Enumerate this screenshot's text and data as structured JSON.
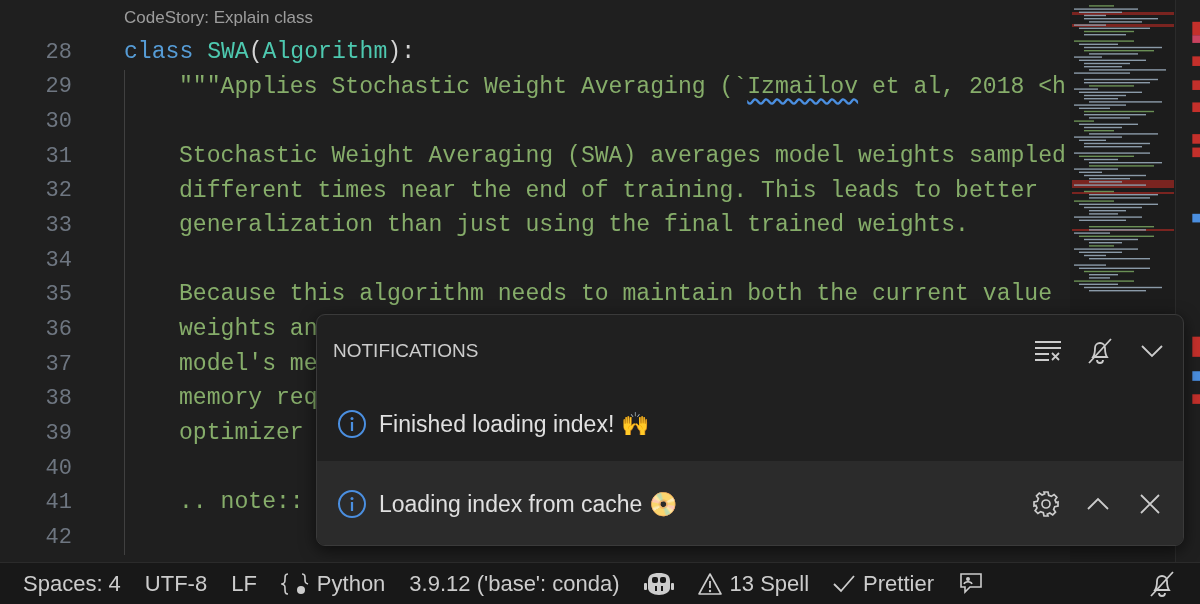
{
  "codelens": "CodeStory: Explain class",
  "lines": [
    {
      "number": "28",
      "indented": false,
      "tokens": [
        {
          "kind": "keyword",
          "text": "class"
        },
        {
          "kind": "class",
          "text": "SWA"
        },
        {
          "kind": "punct",
          "text": "("
        },
        {
          "kind": "class",
          "text": "Algorithm"
        },
        {
          "kind": "punct",
          "text": "):"
        }
      ]
    },
    {
      "number": "29",
      "indented": true,
      "tokens": [
        {
          "kind": "string",
          "text": "\"\"\"Applies Stochastic Weight Averaging (`"
        },
        {
          "kind": "misspelled",
          "text": "Izmailov"
        },
        {
          "kind": "string",
          "text": "et al, 2018 <h"
        }
      ]
    },
    {
      "number": "30",
      "indented": true
    },
    {
      "number": "31",
      "indented": true,
      "tokens": [
        {
          "kind": "string",
          "text": "Stochastic Weight Averaging (SWA) averages model weights sampled"
        }
      ]
    },
    {
      "number": "32",
      "indented": true,
      "tokens": [
        {
          "kind": "string",
          "text": "different times near the end of training. This leads to better"
        }
      ]
    },
    {
      "number": "33",
      "indented": true,
      "tokens": [
        {
          "kind": "string",
          "text": "generalization than just using the final trained weights."
        }
      ]
    },
    {
      "number": "34",
      "indented": true
    },
    {
      "number": "35",
      "indented": true,
      "tokens": [
        {
          "kind": "string",
          "text": "Because this algorithm needs to maintain both the current value"
        }
      ]
    },
    {
      "number": "36",
      "indented": true,
      "tokens": [
        {
          "kind": "string",
          "text": "weights an"
        }
      ]
    },
    {
      "number": "37",
      "indented": true,
      "tokens": [
        {
          "kind": "string",
          "text": "model's me"
        }
      ]
    },
    {
      "number": "38",
      "indented": true,
      "tokens": [
        {
          "kind": "string",
          "text": "memory req"
        }
      ]
    },
    {
      "number": "39",
      "indented": true,
      "tokens": [
        {
          "kind": "string",
          "text": "optimizer"
        }
      ]
    },
    {
      "number": "40",
      "indented": true
    },
    {
      "number": "41",
      "indented": true,
      "tokens": [
        {
          "kind": "string",
          "text": ".. note::"
        }
      ]
    },
    {
      "number": "42",
      "indented": true
    }
  ],
  "notifications": {
    "title": "NOTIFICATIONS",
    "items": [
      {
        "message": "Finished loading index! 🙌",
        "selected": false
      },
      {
        "message": "Loading index from cache 📀",
        "selected": true
      }
    ]
  },
  "status_bar": {
    "spaces": "Spaces: 4",
    "encoding": "UTF-8",
    "eol": "LF",
    "language": "Python",
    "interpreter": "3.9.12 ('base': conda)",
    "spell": "13 Spell",
    "formatter": "Prettier"
  }
}
